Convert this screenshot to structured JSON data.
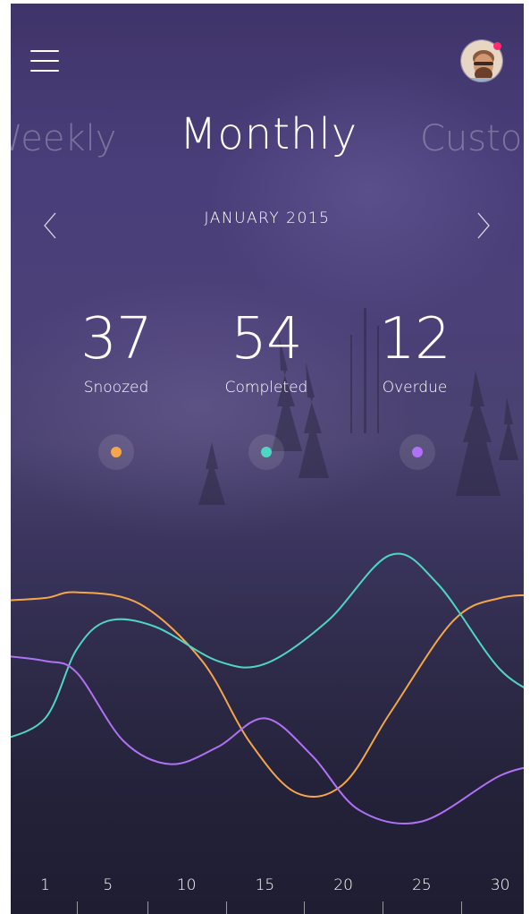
{
  "header": {
    "menu_icon": "hamburger-menu-icon",
    "avatar_icon": "user-avatar",
    "notification_color": "#ff2d6f"
  },
  "tabs": [
    {
      "label": "Weekly",
      "active": false
    },
    {
      "label": "Monthly",
      "active": true
    },
    {
      "label": "Custom",
      "active": false
    }
  ],
  "period": {
    "label": "JANUARY 2015",
    "prev_icon": "chevron-left-icon",
    "next_icon": "chevron-right-icon"
  },
  "stats": [
    {
      "value": "37",
      "label": "Snoozed",
      "color": "#f5a64a"
    },
    {
      "value": "54",
      "label": "Completed",
      "color": "#4fd6c2"
    },
    {
      "value": "12",
      "label": "Overdue",
      "color": "#b072f5"
    }
  ],
  "chart_data": {
    "type": "line",
    "x_ticks": [
      "1",
      "5",
      "10",
      "15",
      "20",
      "25",
      "30"
    ],
    "series": [
      {
        "key": "snoozed",
        "color": "#f5a64a",
        "x": [
          1,
          3,
          7,
          11,
          14,
          17,
          20,
          23,
          27,
          30
        ],
        "y": [
          0.8,
          0.82,
          0.78,
          0.58,
          0.3,
          0.12,
          0.15,
          0.4,
          0.72,
          0.8
        ]
      },
      {
        "key": "completed",
        "color": "#4fd6c2",
        "x": [
          1,
          3,
          5,
          8,
          12,
          15,
          19,
          23,
          26,
          30
        ],
        "y": [
          0.38,
          0.62,
          0.72,
          0.7,
          0.58,
          0.57,
          0.72,
          0.95,
          0.85,
          0.55
        ]
      },
      {
        "key": "overdue",
        "color": "#b072f5",
        "x": [
          1,
          3,
          6,
          9,
          12,
          15,
          18,
          21,
          25,
          30
        ],
        "y": [
          0.58,
          0.54,
          0.3,
          0.22,
          0.28,
          0.38,
          0.25,
          0.06,
          0.02,
          0.18
        ]
      }
    ]
  }
}
